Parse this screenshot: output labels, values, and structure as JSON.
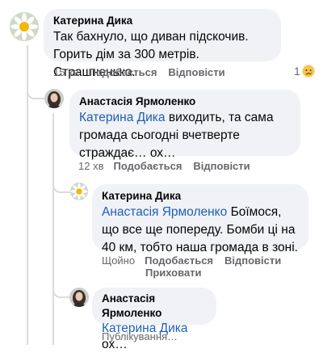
{
  "comments": [
    {
      "author": "Катерина Дика",
      "text": "Так бахнуло, що диван підскочив. Горить дім за 300 метрів. Страшненько.",
      "time": "15 хв",
      "like_label": "Подобається",
      "reply_label": "Відповісти",
      "reaction_count": "1",
      "reaction_icon": "sad-reaction-icon"
    },
    {
      "author": "Анастасія Ярмоленко",
      "mention": "Катерина Дика",
      "text": " виходить, та сама громада сьогодні вчетверте страждає… ох…",
      "time": "12 хв",
      "like_label": "Подобається",
      "reply_label": "Відповісти"
    },
    {
      "author": "Катерина Дика",
      "mention": "Анастасія Ярмоленко",
      "text": " Боїмося, що все ще попереду. Бомби ці на 40 км, тобто наша громада в зоні.",
      "time": "Щойно",
      "like_label": "Подобається",
      "reply_label": "Відповісти",
      "hide_label": "Приховати"
    },
    {
      "author": "Анастасія Ярмоленко",
      "mention": "Катерина Дика",
      "text": " ох…",
      "status": "Публікування…"
    }
  ],
  "colors": {
    "bubble": "#f0f2f5",
    "mention": "#1d5fb8",
    "meta": "#65676b",
    "thread_line": "#d9dbde"
  }
}
